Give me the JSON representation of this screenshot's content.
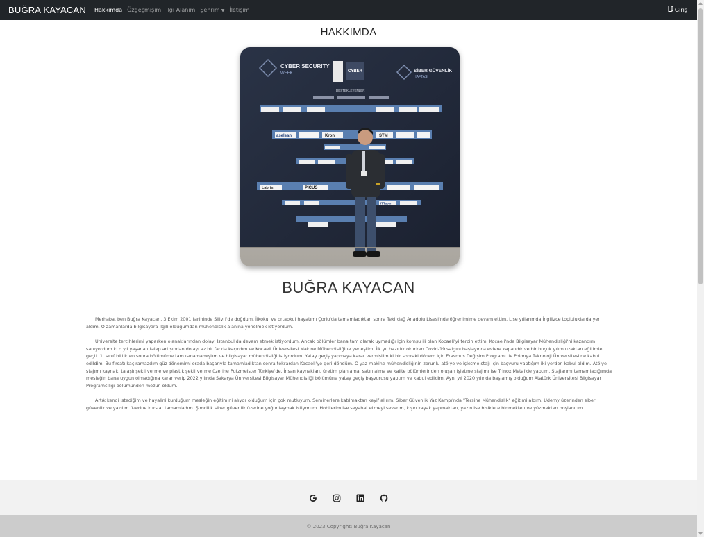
{
  "navbar": {
    "brand": "BUĞRA KAYACAN",
    "links": [
      {
        "label": "Hakkımda",
        "active": true
      },
      {
        "label": "Özgeçmişim",
        "active": false
      },
      {
        "label": "İlgi Alanım",
        "active": false
      },
      {
        "label": "Şehrim",
        "active": false,
        "dropdown": true
      },
      {
        "label": "İletişim",
        "active": false
      }
    ],
    "login_label": "Giriş",
    "login_icon": "login-icon"
  },
  "main": {
    "section_title": "HAKKIMDA",
    "photo_banner": {
      "event": "CYBER SECURITY WEEK",
      "event_tr": "SİBER GÜVENLİK HAFTASI",
      "sponsors_heading": "DESTEKLEYENLER",
      "logos": [
        "aselsan",
        "Kron",
        "STM",
        "PICUS",
        "Labris",
        "ITTaber"
      ]
    },
    "name": "BUĞRA KAYACAN",
    "bio_paragraphs": [
      "Merhaba, ben Buğra Kayacan. 3 Ekim 2001 tarihinde Silivri'de doğdum. İlkokul ve ortaokul hayatımı Çorlu'da tamamladıktan sonra Tekirdağ Anadolu Lisesi'nde öğrenimime devam ettim. Lise yıllarımda İngilizce topluluklarda yer aldım. O zamanlarda bilgisayara ilgili olduğumdan mühendislik alanına yönelmek istiyordum.",
      "Üniversite tercihlerimi yaparken olanaklarından dolayı İstanbul'da devam etmek istiyordum. Ancak bölümler bana tam olarak uymadığı için komşu ili olan Kocaeli'yi tercih ettim. Kocaeli'nde Bilgisayar Mühendisliği'ni kazandım sanıyordum ki o yıl yaşanan talep artışından dolayı az bir farkla kaçırdım ve Kocaeli Üniversitesi Makine Mühendisliğine yerleştim. İlk yıl hazırlık okurken Covid-19 salgını başlayınca evlere kapandık ve bir buçuk yılım uzaktan eğitimle geçti. 1. sınıf bittikten sonra bölümüme tam ısınamamıştım ve bilgisayar mühendisliği istiyordum. Yatay geçiş yapmaya karar vermiştim ki bir sonraki dönem için Erasmus Değişim Programı ile Polonya Teknoloji Üniversitesi'ne kabul edildim. Bu fırsatı kaçıramazdım güz dönemimi orada başarıyla tamamladıktan sonra tekrardan Kocaeli'ye geri döndüm. O yaz makine mühendisliğinin zorunlu atölye ve işletme stajı için başvuru yaptığım iki yerden kabul aldım. Atölye stajımı kaynak, talaşlı şekil verme ve plastik şekil verme üzerine Putzmeister Türkiye'de. İnsan kaynakları, üretim planlama, satın alma ve kalite bölümlerinden oluşan işletme stajımı ise Trinox Metal'de yaptım. Stajlarımı tamamladığımda mesleğin bana uygun olmadığına karar verip 2022 yılında Sakarya Üniversitesi Bilgisayar Mühendisliği bölümüne yatay geçiş başvurusu yaptım ve kabul edildim. Aynı yıl 2020 yılında başlamış olduğum Atatürk Üniversitesi Bilgisayar Programcılığı bölümünden mezun oldum.",
      "Artık kendi istediğim ve hayalini kurduğum mesleğin eğitimini alıyor olduğum için çok mutluyum. Seminerlere katılmaktan keyif alırım. Siber Güvenlik Yaz Kampı'nda \"Tersine Mühendislik\" eğitimi aldım. Udemy üzerinden siber güvenlik ve yazılım üzerine kurslar tamamladım. Şimdilik siber güvenlik üzerine yoğunlaşmak istiyorum. Hobilerim ise seyahat etmeyi severim, kışın kayak yapmaktan, yazın ise bisiklete binmekten ve yüzmekten hoşlanırım."
    ]
  },
  "footer": {
    "social_icons": [
      "google-icon",
      "instagram-icon",
      "linkedin-icon",
      "github-icon"
    ],
    "copyright": "© 2023 Copyright: Buğra Kayacan"
  },
  "colors": {
    "navbar_bg": "#212529",
    "footer_bg": "#f2f2f2",
    "copyright_bg": "#cccccc"
  }
}
